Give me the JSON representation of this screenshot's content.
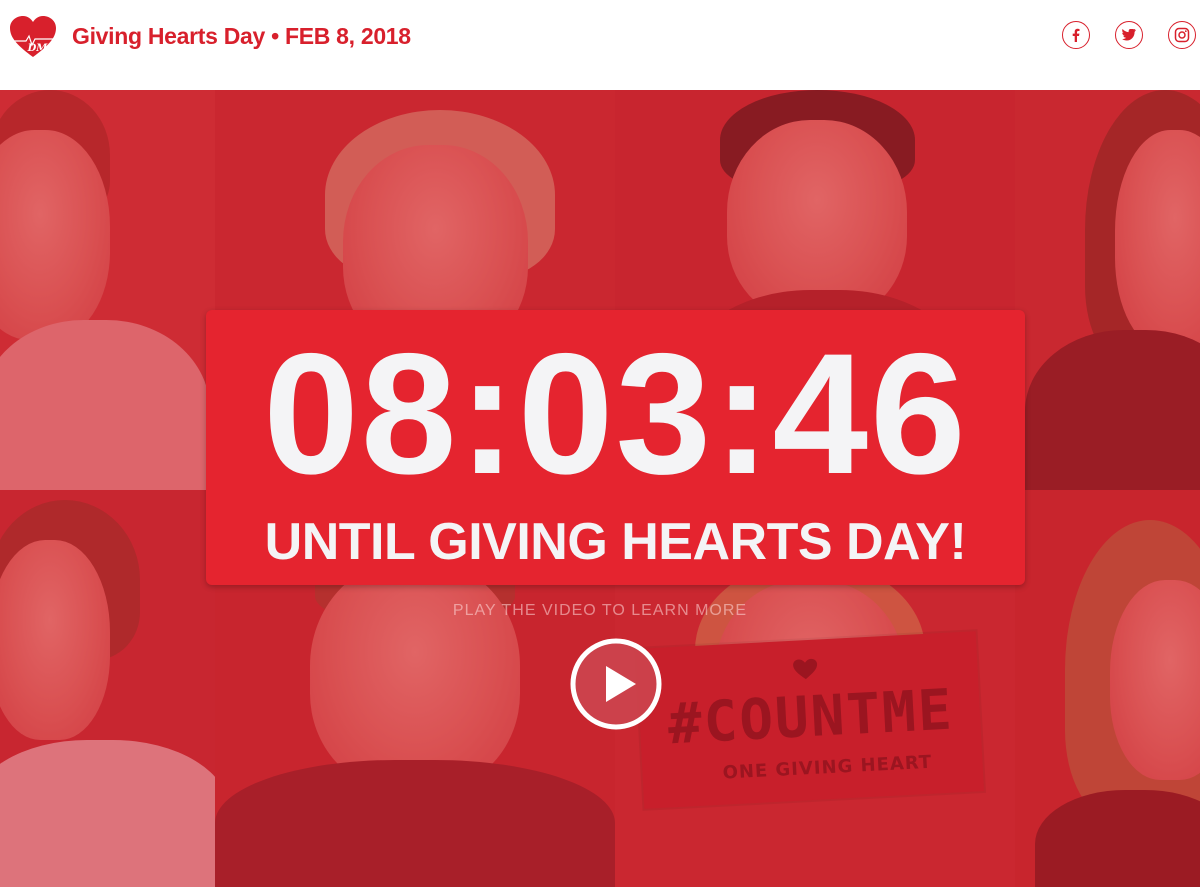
{
  "header": {
    "title": "Giving Hearts Day • FEB 8, 2018",
    "logo_text": "DMF",
    "social": [
      {
        "name": "facebook-icon"
      },
      {
        "name": "twitter-icon"
      },
      {
        "name": "instagram-icon"
      }
    ]
  },
  "countdown": {
    "time": "08:03:46",
    "subtitle": "UNTIL GIVING HEARTS DAY!"
  },
  "video": {
    "note": "PLAY THE VIDEO TO LEARN MORE"
  },
  "sign": {
    "hashtag": "#COUNTME",
    "subtitle": "ONE GIVING HEART"
  },
  "colors": {
    "brand_red": "#d8202c",
    "countdown_bg": "#e5242f",
    "text_light": "#f4f4f6"
  }
}
